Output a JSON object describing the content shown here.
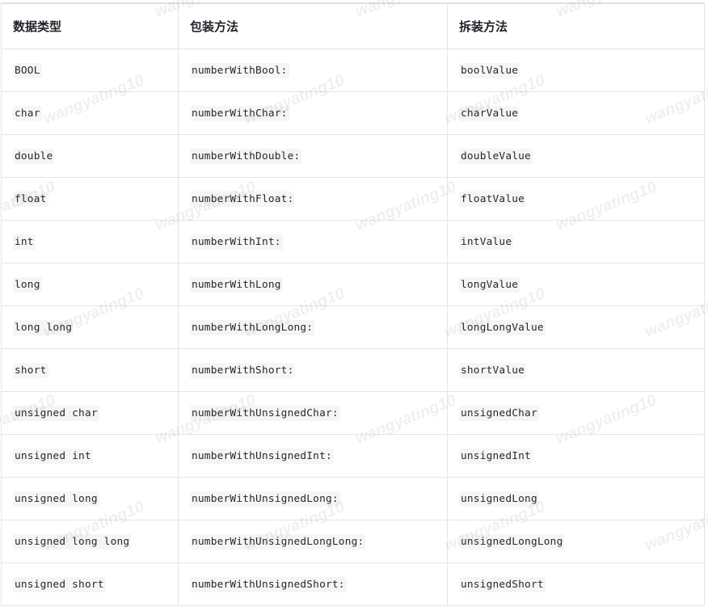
{
  "watermark": {
    "text": "wangyating10",
    "repeat_count": 24
  },
  "table": {
    "headers": [
      {
        "label": "数据类型"
      },
      {
        "label": "包装方法"
      },
      {
        "label": "拆装方法"
      }
    ],
    "rows": [
      {
        "type": "BOOL",
        "box": "numberWithBool:",
        "unbox": "boolValue"
      },
      {
        "type": "char",
        "box": "numberWithChar:",
        "unbox": "charValue"
      },
      {
        "type": "double",
        "box": "numberWithDouble:",
        "unbox": "doubleValue"
      },
      {
        "type": "float",
        "box": "numberWithFloat:",
        "unbox": "floatValue"
      },
      {
        "type": "int",
        "box": "numberWithInt:",
        "unbox": "intValue"
      },
      {
        "type": "long",
        "box": "numberWithLong",
        "unbox": "longValue"
      },
      {
        "type": "long long",
        "box": "numberWithLongLong:",
        "unbox": "longLongValue"
      },
      {
        "type": "short",
        "box": "numberWithShort:",
        "unbox": "shortValue"
      },
      {
        "type": "unsigned char",
        "box": "numberWithUnsignedChar:",
        "unbox": "unsignedChar"
      },
      {
        "type": "unsigned int",
        "box": "numberWithUnsignedInt:",
        "unbox": "unsignedInt"
      },
      {
        "type": "unsigned long",
        "box": "numberWithUnsignedLong:",
        "unbox": "unsignedLong"
      },
      {
        "type": "unsigned long long",
        "box": "numberWithUnsignedLongLong:",
        "unbox": "unsignedLongLong"
      },
      {
        "type": "unsigned short",
        "box": "numberWithUnsignedShort:",
        "unbox": "unsignedShort"
      }
    ]
  },
  "colors": {
    "border": "#e3e5e8",
    "header_text": "#1f2328",
    "body_text": "#24292e",
    "code_bg": "rgba(27,31,35,0.045)",
    "page_bg": "#ffffff"
  }
}
